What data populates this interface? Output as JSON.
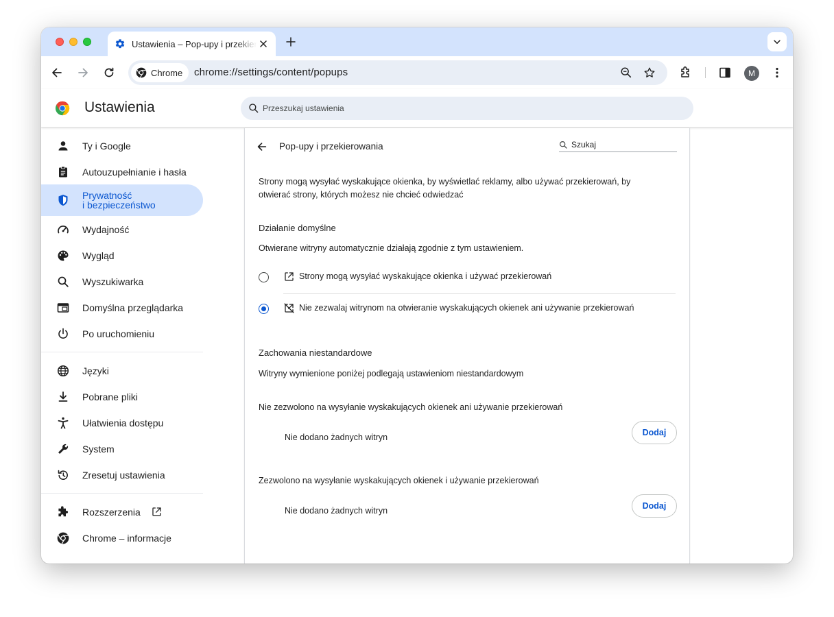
{
  "browser": {
    "tab": {
      "title": "Ustawienia – Pop-upy i przekierowania"
    },
    "address": {
      "chip_label": "Chrome",
      "url": "chrome://settings/content/popups"
    },
    "profile_initial": "M"
  },
  "header": {
    "app_title": "Ustawienia",
    "search_placeholder": "Przeszukaj ustawienia"
  },
  "sidebar": {
    "items": [
      {
        "label": "Ty i Google",
        "icon": "person-icon"
      },
      {
        "label": "Autouzupełnianie i hasła",
        "icon": "clipboard-icon"
      },
      {
        "label": "Prywatność\ni bezpieczeństwo",
        "icon": "shield-icon",
        "active": true
      },
      {
        "label": "Wydajność",
        "icon": "speedometer-icon"
      },
      {
        "label": "Wygląd",
        "icon": "palette-icon"
      },
      {
        "label": "Wyszukiwarka",
        "icon": "search-icon"
      },
      {
        "label": "Domyślna przeglądarka",
        "icon": "browser-window-icon"
      },
      {
        "label": "Po uruchomieniu",
        "icon": "power-icon"
      },
      {
        "label": "Języki",
        "icon": "globe-icon"
      },
      {
        "label": "Pobrane pliki",
        "icon": "download-icon"
      },
      {
        "label": "Ułatwienia dostępu",
        "icon": "accessibility-icon"
      },
      {
        "label": "System",
        "icon": "wrench-icon"
      },
      {
        "label": "Zresetuj ustawienia",
        "icon": "reset-history-icon"
      },
      {
        "label": "Rozszerzenia",
        "icon": "puzzle-icon"
      },
      {
        "label": "Chrome – informacje",
        "icon": "chrome-logo-icon"
      }
    ]
  },
  "page": {
    "title": "Pop-upy i przekierowania",
    "search_placeholder": "Szukaj",
    "description": "Strony mogą wysyłać wyskakujące okienka, by wyświetlać reklamy, albo używać przekierowań, by otwierać strony, których możesz nie chcieć odwiedzać",
    "default_behavior": {
      "title": "Działanie domyślne",
      "subtitle": "Otwierane witryny automatycznie działają zgodnie z tym ustawieniem.",
      "options": [
        {
          "label": "Strony mogą wysyłać wyskakujące okienka i używać przekierowań",
          "checked": false
        },
        {
          "label": "Nie zezwalaj witrynom na otwieranie wyskakujących okienek ani używanie przekierowań",
          "checked": true
        }
      ]
    },
    "custom_behavior": {
      "title": "Zachowania niestandardowe",
      "subtitle": "Witryny wymienione poniżej podlegają ustawieniom niestandardowym",
      "blocked": {
        "label": "Nie zezwolono na wysyłanie wyskakujących okienek ani używanie przekierowań",
        "button": "Dodaj",
        "empty": "Nie dodano żadnych witryn"
      },
      "allowed": {
        "label": "Zezwolono na wysyłanie wyskakujących okienek i używanie przekierowań",
        "button": "Dodaj",
        "empty": "Nie dodano żadnych witryn"
      }
    }
  },
  "colors": {
    "accent": "#0b57d0",
    "tabstrip": "#d3e3fd",
    "omnibox": "#e9eef6"
  }
}
